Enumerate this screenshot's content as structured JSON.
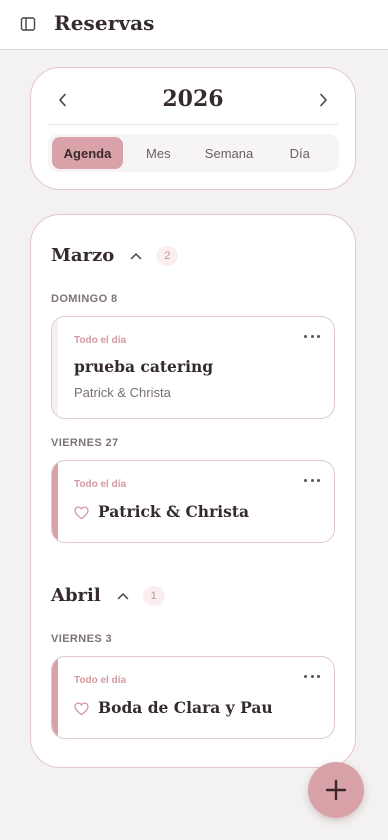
{
  "app": {
    "title": "Reservas"
  },
  "calendar": {
    "year": "2026",
    "tabs": [
      "Agenda",
      "Mes",
      "Semana",
      "Día"
    ],
    "active_tab": "Agenda"
  },
  "agenda": {
    "months": [
      {
        "name": "Marzo",
        "count": "2",
        "days": [
          {
            "label": "DOMINGO 8",
            "events": [
              {
                "time": "Todo el día",
                "title": "prueba catering",
                "subtitle": "Patrick & Christa"
              }
            ]
          },
          {
            "label": "VIERNES 27",
            "events": [
              {
                "time": "Todo el día",
                "title": "Patrick & Christa"
              }
            ]
          }
        ]
      },
      {
        "name": "Abril",
        "count": "1",
        "days": [
          {
            "label": "VIERNES 3",
            "events": [
              {
                "time": "Todo el día",
                "title": "Boda de Clara y Pau"
              }
            ]
          }
        ]
      }
    ]
  },
  "colors": {
    "accent": "#d9a2a9",
    "accent_text": "#d39aa2",
    "border": "#e4c7cb",
    "background": "#f3f1f1"
  },
  "icons": {
    "sidebar": "sidebar-toggle-icon",
    "prev": "chevron-left-icon",
    "next": "chevron-right-icon",
    "collapse": "chevron-up-icon",
    "more": "more-horizontal-icon",
    "heart": "heart-icon",
    "add": "plus-icon"
  }
}
